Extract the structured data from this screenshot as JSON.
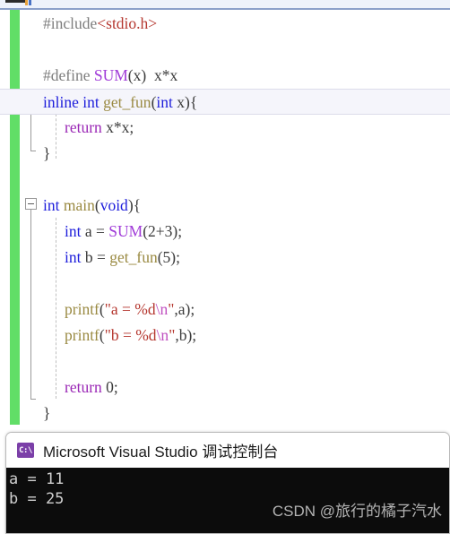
{
  "editor": {
    "language": "c",
    "change_bar_color": "#61de67",
    "current_line_highlight": "#f5f5fb",
    "colors": {
      "preprocessor": "#7d7d7d",
      "keyword": "#1d1ddb",
      "macro": "#a03bd8",
      "control": "#9a26b5",
      "function": "#9a8a42",
      "string": "#b5372f",
      "escape": "#c04fc0",
      "plain": "#3b3b3b"
    },
    "lines": [
      {
        "text": "#include<stdio.h>"
      },
      {
        "text": ""
      },
      {
        "text": "#define SUM(x) x*x"
      },
      {
        "text": "inline int get_fun(int x){"
      },
      {
        "text": "    return x*x;"
      },
      {
        "text": "}"
      },
      {
        "text": ""
      },
      {
        "text": "int main(void){"
      },
      {
        "text": "    int a = SUM(2+3);"
      },
      {
        "text": "    int b = get_fun(5);"
      },
      {
        "text": ""
      },
      {
        "text": "    printf(\"a = %d\\n\",a);"
      },
      {
        "text": "    printf(\"b = %d\\n\",b);"
      },
      {
        "text": ""
      },
      {
        "text": "    return 0;"
      },
      {
        "text": "}"
      }
    ],
    "tokens": {
      "include_directive": "#include",
      "include_header": "<stdio.h>",
      "define_directive": "#define",
      "define_name": "SUM",
      "define_params": "(x)",
      "define_body": "x*x",
      "kw_inline": "inline",
      "kw_int": "int",
      "fn_get_fun": "get_fun",
      "fn_main": "main",
      "fn_printf": "printf",
      "kw_void": "void",
      "kw_return": "return",
      "var_a": "a",
      "var_b": "b",
      "var_x": "x",
      "expr_xx": "x*x",
      "lit_zero": "0",
      "lit_five": "5",
      "expr_2plus3": "2+3",
      "str_a": "\"a = %d",
      "str_b": "\"b = %d",
      "escape_n": "\\n",
      "quote_close": "\""
    },
    "fold_markers": [
      {
        "label": "collapse-get-fun",
        "glyph": "minus"
      },
      {
        "label": "collapse-main",
        "glyph": "minus"
      }
    ]
  },
  "console": {
    "icon_name": "cmd-icon",
    "icon_glyph": "C:\\",
    "icon_color": "#7b3fa8",
    "title": "Microsoft Visual Studio 调试控制台",
    "background": "#0c0c0c",
    "text_color": "#cfcfcf",
    "output_lines": [
      "a = 11",
      "b = 25"
    ],
    "watermark": "CSDN @旅行的橘子汽水"
  }
}
